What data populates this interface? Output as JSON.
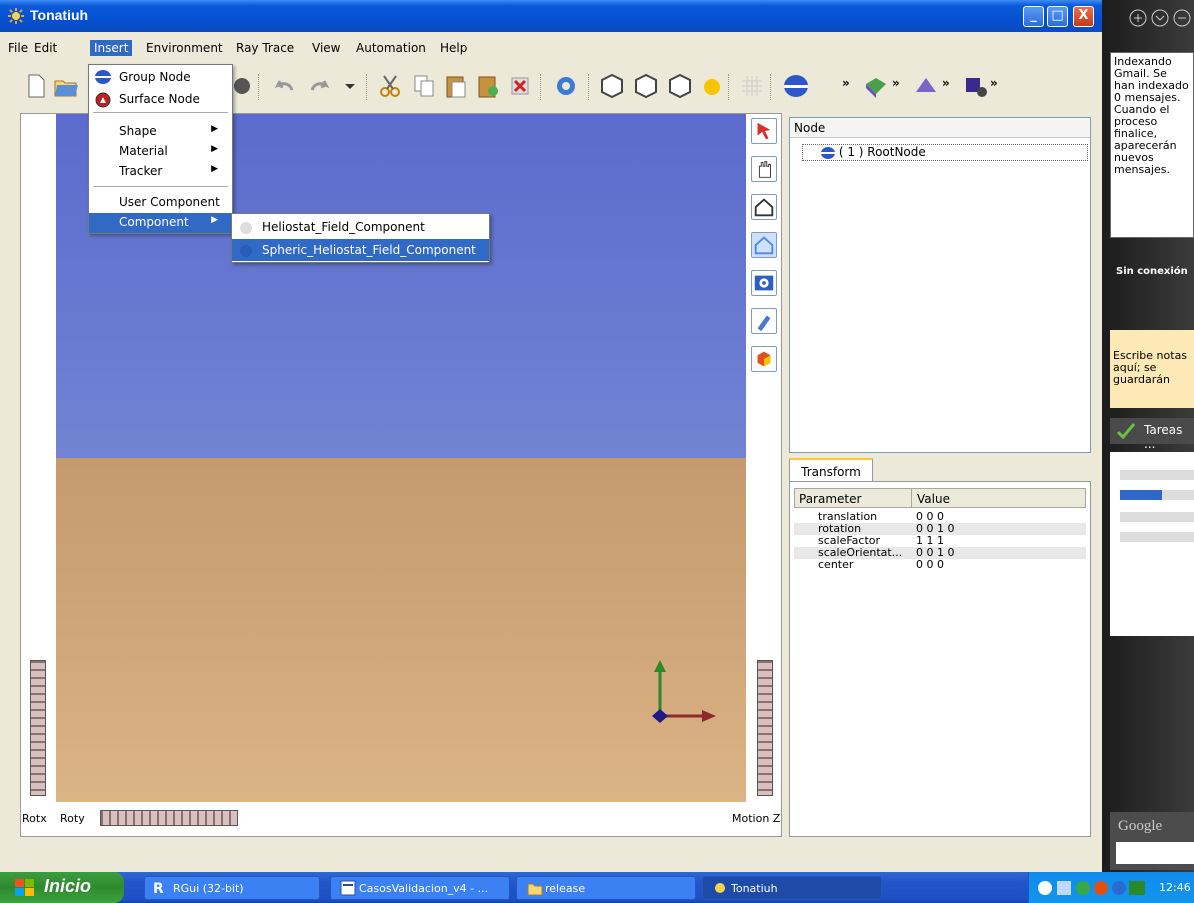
{
  "window": {
    "title": "Tonatiuh",
    "minimize": "_",
    "maximize": "□",
    "close": "X"
  },
  "menubar": [
    "File",
    "Edit",
    "Insert",
    "Environment",
    "Ray Trace",
    "View",
    "Automation",
    "Help"
  ],
  "insert_menu": {
    "group_node": "Group Node",
    "surface_node": "Surface Node",
    "shape": "Shape",
    "material": "Material",
    "tracker": "Tracker",
    "user_component": "User Component",
    "component": "Component"
  },
  "component_menu": {
    "item1": "Heliostat_Field_Component",
    "item2": "Spheric_Heliostat_Field_Component"
  },
  "toolbar_more": "»",
  "viewer": {
    "rotx": "Rotx",
    "roty": "Roty",
    "motion_z": "Motion Z"
  },
  "tree": {
    "header": "Node",
    "root": "( 1 ) RootNode"
  },
  "transform": {
    "tab": "Transform",
    "col_param": "Parameter",
    "col_value": "Value",
    "rows": [
      {
        "p": "translation",
        "v": "0 0 0"
      },
      {
        "p": "rotation",
        "v": "0 0 1  0"
      },
      {
        "p": "scaleFactor",
        "v": "1 1 1"
      },
      {
        "p": "scaleOrientat...",
        "v": "0 0 1  0"
      },
      {
        "p": "center",
        "v": "0 0 0"
      }
    ]
  },
  "gadgets": {
    "mail": "Indexando Gmail. Se han indexado 0 mensajes. Cuando el proceso finalice, aparecerán nuevos mensajes.",
    "offline": "Sin conexión",
    "notes": "Escribe notas aquí; se guardarán",
    "tasks": "Tareas ..."
  },
  "taskbar": {
    "start": "Inicio",
    "tasks": [
      "RGui (32-bit)",
      "CasosValidacion_v4 - ...",
      "release",
      "Tonatiuh"
    ],
    "clock": "12:46"
  }
}
